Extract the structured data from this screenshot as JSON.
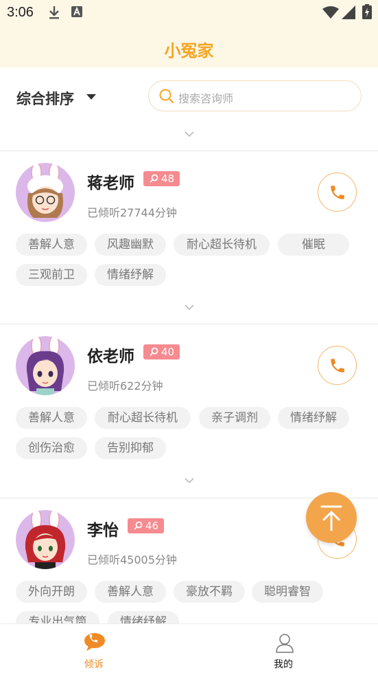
{
  "status_bar": {
    "time": "3:06"
  },
  "header": {
    "title": "小冤家"
  },
  "toolbar": {
    "sort_label": "综合排序",
    "search_placeholder": "搜索咨询师"
  },
  "counselors": [
    {
      "name": "蒋老师",
      "badge": "48",
      "listened": "已倾听27744分钟",
      "tags": [
        "善解人意",
        "风趣幽默",
        "耐心超长待机",
        "催眠",
        "三观前卫",
        "情绪纾解"
      ]
    },
    {
      "name": "依老师",
      "badge": "40",
      "listened": "已倾听622分钟",
      "tags": [
        "善解人意",
        "耐心超长待机",
        "亲子调剂",
        "情绪纾解",
        "创伤治愈",
        "告别抑郁"
      ]
    },
    {
      "name": "李怡",
      "badge": "46",
      "listened": "已倾听45005分钟",
      "tags": [
        "外向开朗",
        "善解人意",
        "豪放不羁",
        "聪明睿智",
        "专业出气筒",
        "情绪纾解"
      ]
    }
  ],
  "tabs": [
    {
      "label": "倾诉",
      "active": true
    },
    {
      "label": "我的",
      "active": false
    }
  ],
  "colors": {
    "accent": "#f5a623",
    "badge": "#f58b90",
    "header_bg": "#fdf7e6"
  }
}
